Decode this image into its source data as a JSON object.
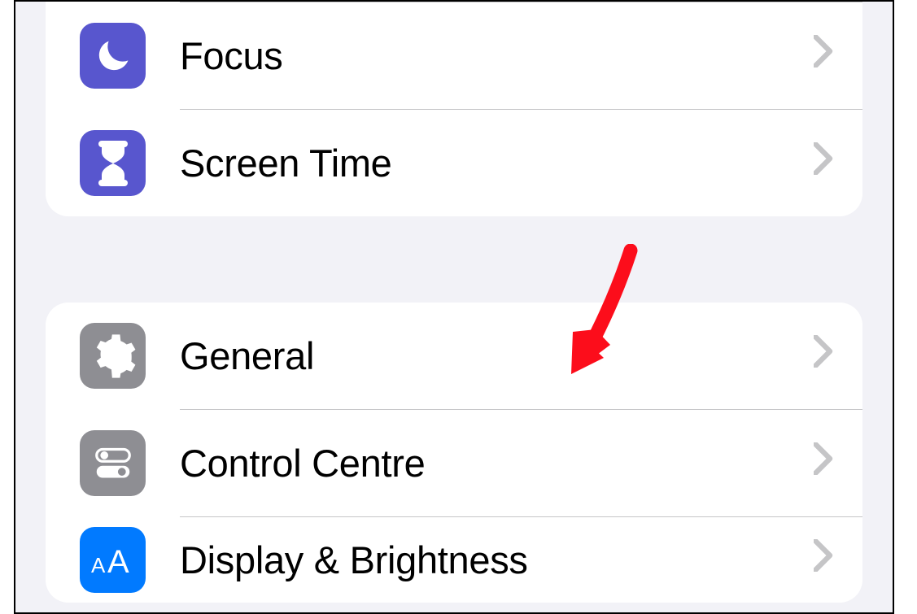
{
  "colors": {
    "page_bg": "#f2f2f7",
    "card_bg": "#ffffff",
    "separator": "#c6c6c8",
    "chevron": "#c5c5c7",
    "icon_purple": "#5856ce",
    "icon_gray": "#8e8e93",
    "icon_blue": "#017aff",
    "icon_red": "#eb4e3e",
    "annotation_arrow": "#fc0d1b"
  },
  "group1": {
    "items": [
      {
        "label": "",
        "icon": "unknown-icon",
        "icon_bg": "icon_red"
      },
      {
        "label": "Focus",
        "icon": "moon-icon",
        "icon_bg": "icon_purple"
      },
      {
        "label": "Screen Time",
        "icon": "hourglass-icon",
        "icon_bg": "icon_purple"
      }
    ]
  },
  "group2": {
    "items": [
      {
        "label": "General",
        "icon": "gear-icon",
        "icon_bg": "icon_gray"
      },
      {
        "label": "Control Centre",
        "icon": "toggles-icon",
        "icon_bg": "icon_gray"
      },
      {
        "label": "Display & Brightness",
        "icon": "text-size-icon",
        "icon_bg": "icon_blue"
      }
    ]
  }
}
